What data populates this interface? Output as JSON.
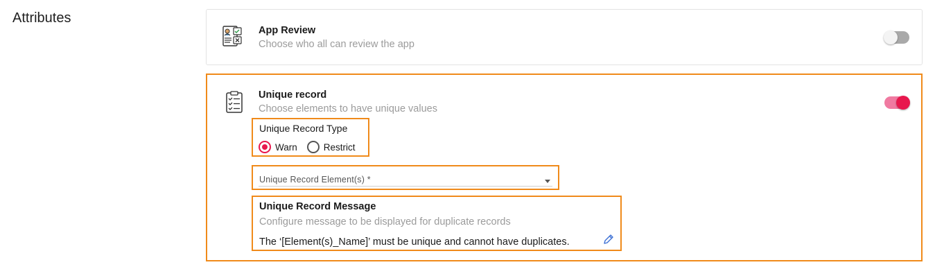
{
  "section": {
    "title": "Attributes"
  },
  "app_review": {
    "title": "App Review",
    "subtitle": "Choose who all can review the app",
    "icon": "review-checklist-icon",
    "enabled": false
  },
  "unique_record": {
    "title": "Unique record",
    "subtitle": "Choose elements to have unique values",
    "icon": "clipboard-list-icon",
    "enabled": true,
    "type": {
      "label": "Unique Record Type",
      "options": [
        {
          "label": "Warn",
          "selected": true
        },
        {
          "label": "Restrict",
          "selected": false
        }
      ]
    },
    "elements": {
      "placeholder": "Unique Record Element(s) *"
    },
    "message": {
      "title": "Unique Record Message",
      "subtitle": "Configure message to be displayed for duplicate records",
      "text": "The ‘[Element(s)_Name]’ must be unique and cannot have duplicates."
    }
  },
  "colors": {
    "accent": "#e8184d",
    "accent_light": "#f07aa1",
    "highlight": "#f08a1a",
    "muted_text": "#9b9b9b"
  }
}
